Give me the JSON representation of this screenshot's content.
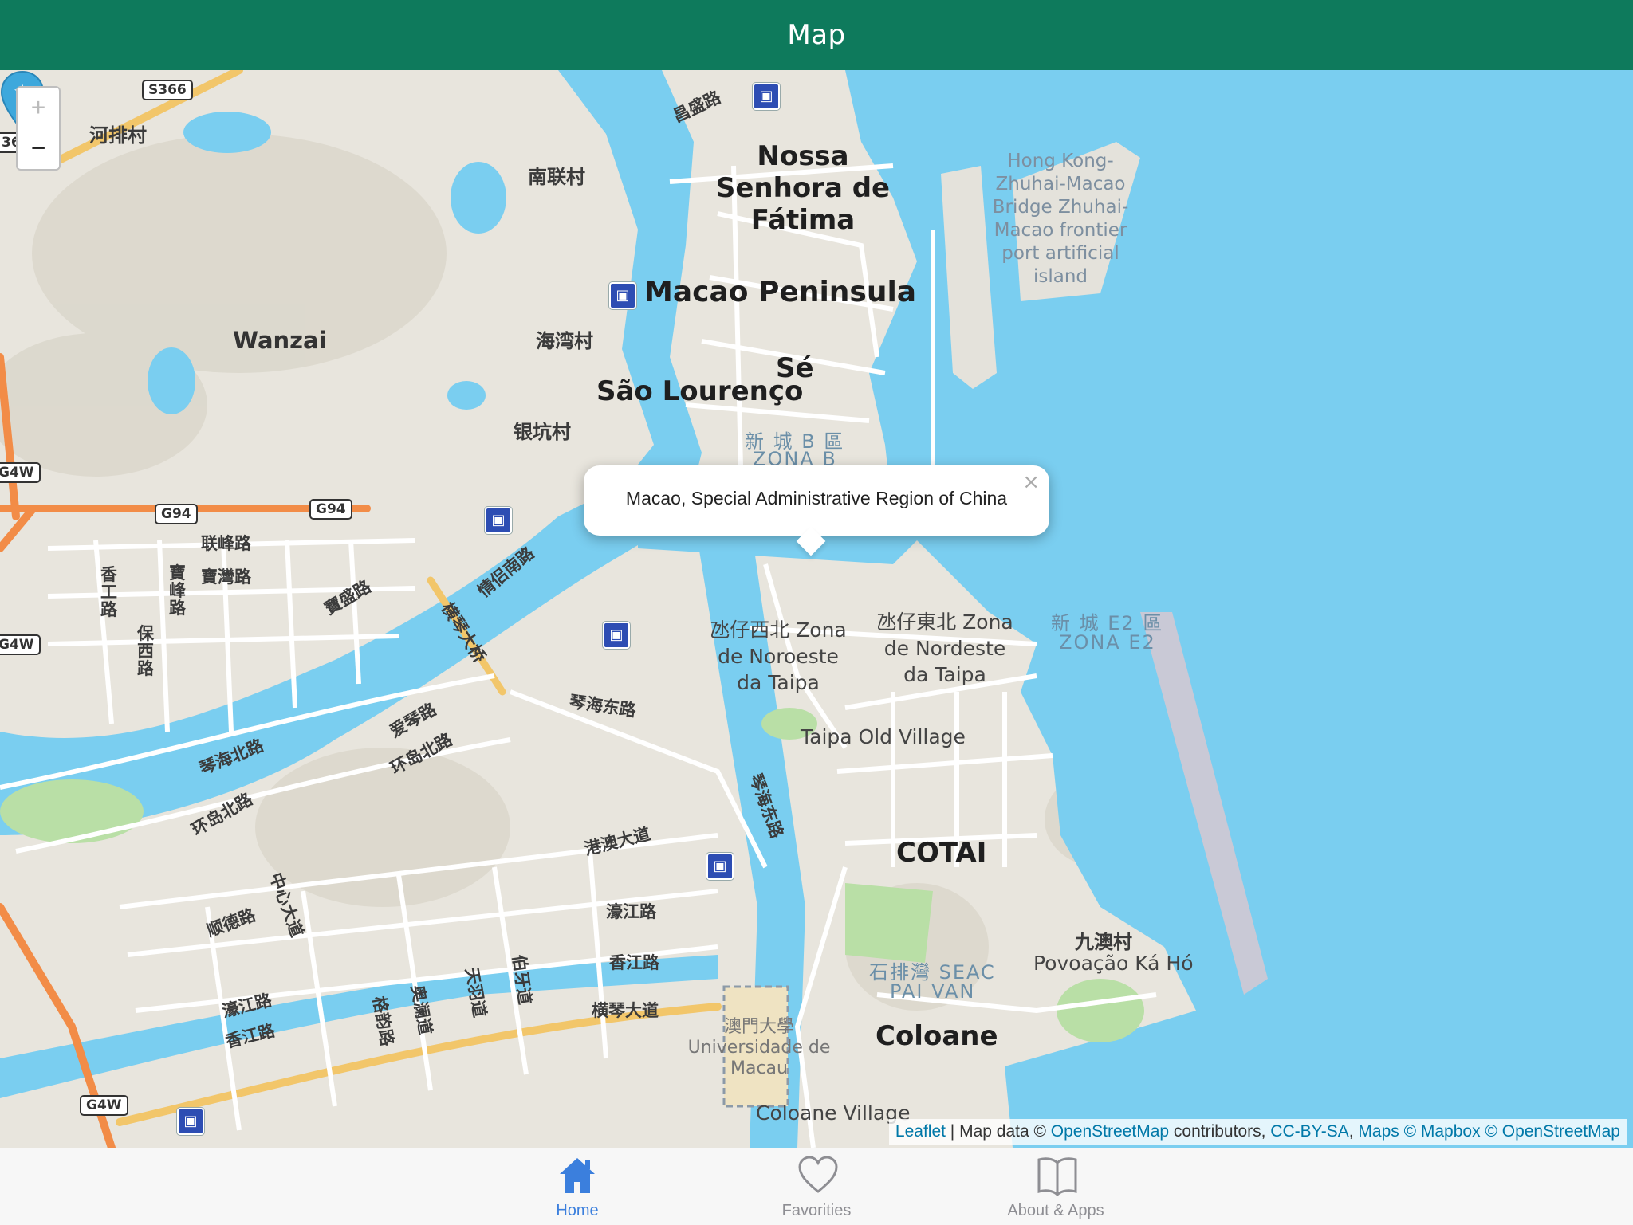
{
  "header": {
    "title": "Map"
  },
  "zoom": {
    "in_label": "+",
    "out_label": "−"
  },
  "popup": {
    "text": "Macao, Special Administrative Region of China",
    "close": "×"
  },
  "map_labels": {
    "nossa_senhora": "Nossa Senhora de Fátima",
    "macao_peninsula": "Macao Peninsula",
    "se": "Sé",
    "sao_lourenco": "São Lourenço",
    "zona_b_cn": "新 城 B 區",
    "zona_b": "ZONA B",
    "hkzm_bridge": "Hong Kong-Zhuhai-Macao Bridge Zhuhai-Macao frontier port artificial island",
    "wanzai": "Wanzai",
    "taipa_nw": "氹仔西北 Zona de Noroeste da Taipa",
    "taipa_ne": "氹仔東北 Zona de Nordeste da Taipa",
    "zona_e2_cn": "新 城 E2 區",
    "zona_e2": "ZONA E2",
    "taipa_old_village": "Taipa Old Village",
    "cotai": "COTAI",
    "seac_pai_van_cn": "石排灣 SEAC",
    "seac_pai_van": "PAI VAN",
    "ka_ho_cn": "九澳村",
    "ka_ho": "Povoação Ká Hó",
    "coloane": "Coloane",
    "coloane_village": "Coloane Village",
    "university_cn": "澳門大學",
    "university": "Universidade de Macau",
    "hepaicun": "河排村",
    "nanliancun": "南联村",
    "haiwancun": "海湾村",
    "yinkengcun": "银坑村",
    "lianfeng": "联峰路",
    "baowan": "寶灣路",
    "baofeng": "寶峰路",
    "xianggong": "香工路",
    "baoxi": "保西路",
    "baosheng": "寶盛路",
    "qinglv": "情侣南路",
    "hengqin_bridge": "横琴大桥",
    "qinhai_east": "琴海东路",
    "aiqin": "爱琴路",
    "huandao_north": "环岛北路",
    "qinhai_north": "琴海北路",
    "huandao_north2": "环岛北路",
    "gangao": "港澳大道",
    "haojiang": "濠江路",
    "xiangjiang": "香江路",
    "hengqin_ave": "横琴大道",
    "zhongxin": "中心大道",
    "shunde": "顺德路",
    "haojiang2": "濠江路",
    "xiangjiang2": "香江路",
    "geyun": "格韵路",
    "aolan": "奥澜道",
    "tianyu": "天羽道",
    "boya": "伯牙道",
    "qinhai_east2": "琴海东路",
    "changsheng": "昌盛路"
  },
  "shields": {
    "s366": "S366",
    "g94a": "G94",
    "g94b": "G94",
    "g4w_top": "G4W",
    "g4w_mid": "G4W",
    "g4w_bottom": "G4W",
    "s36": "36"
  },
  "attribution": {
    "leaflet": "Leaflet",
    "sep": " | Map data © ",
    "osm": "OpenStreetMap",
    "contrib": " contributors, ",
    "license": "CC-BY-SA",
    "comma": ", ",
    "mapbox": "Maps © Mapbox © OpenStreetMap"
  },
  "tabs": [
    {
      "label": "Home",
      "icon": "home-icon",
      "active": true
    },
    {
      "label": "Favorities",
      "icon": "heart-icon",
      "active": false
    },
    {
      "label": "About & Apps",
      "icon": "book-icon",
      "active": false
    }
  ],
  "colors": {
    "header": "#0e7a5c",
    "water": "#7acef0",
    "land": "#e8e5dd",
    "active_tab": "#3b7fdd",
    "marker": "#3ea8dc"
  }
}
